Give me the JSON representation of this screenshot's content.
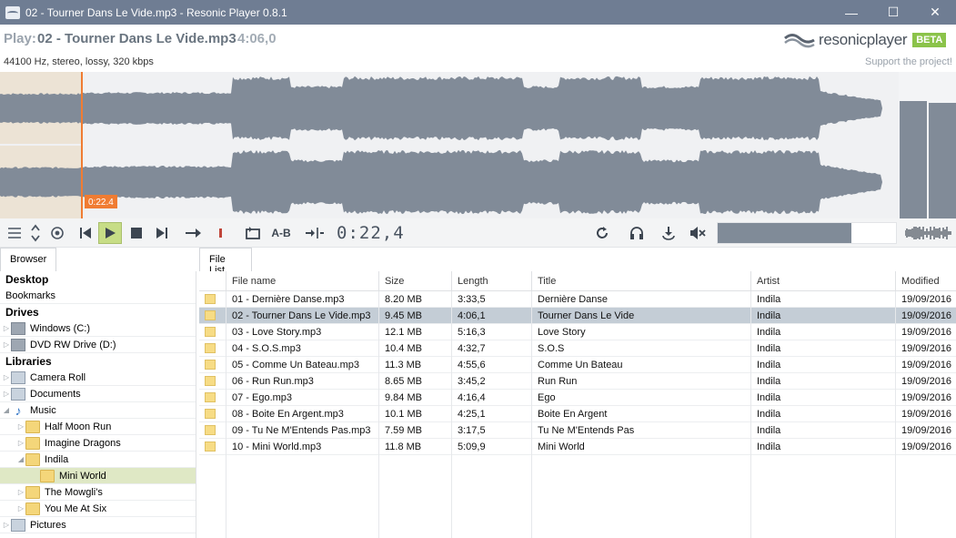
{
  "window": {
    "title": "02 - Tourner Dans Le Vide.mp3 - Resonic Player 0.8.1",
    "minimize": "—",
    "maximize": "☐",
    "close": "✕"
  },
  "header": {
    "play_label": "Play:",
    "file": "02 - Tourner Dans Le Vide.mp3",
    "duration": "4:06,0",
    "logo_text_1": "resonic",
    "logo_text_2": "player",
    "beta": "BETA"
  },
  "info": {
    "format": "44100 Hz, stereo, lossy, 320 kbps",
    "support": "Support the project!"
  },
  "waveform": {
    "playhead_label": "0:22.4",
    "playhead_fraction": 0.091,
    "vu_levels": [
      0.8,
      0.79
    ],
    "colors": {
      "wave": "#818b98",
      "played_bg": "#ece3d5",
      "playhead": "#f07c32"
    }
  },
  "toolbar": {
    "timecode": "0:22,4",
    "ab_label": "A-B",
    "progress_fraction": 0.75
  },
  "tabs": {
    "browser": "Browser",
    "file_list": "File List"
  },
  "browser": [
    {
      "label": "Desktop",
      "kind": "section"
    },
    {
      "label": "Bookmarks",
      "kind": "plain"
    },
    {
      "label": "Drives",
      "kind": "section"
    },
    {
      "label": "Windows (C:)",
      "kind": "drive",
      "depth": 0
    },
    {
      "label": "DVD RW Drive (D:)",
      "kind": "drive",
      "depth": 0
    },
    {
      "label": "Libraries",
      "kind": "section"
    },
    {
      "label": "Camera Roll",
      "kind": "library",
      "depth": 0
    },
    {
      "label": "Documents",
      "kind": "library",
      "depth": 0
    },
    {
      "label": "Music",
      "kind": "music",
      "depth": 0,
      "expanded": true
    },
    {
      "label": "Half Moon Run",
      "kind": "folder",
      "depth": 1
    },
    {
      "label": "Imagine Dragons",
      "kind": "folder",
      "depth": 1
    },
    {
      "label": "Indila",
      "kind": "folder",
      "depth": 1,
      "expanded": true
    },
    {
      "label": "Mini World",
      "kind": "folder",
      "depth": 2,
      "selected": true
    },
    {
      "label": "The Mowgli's",
      "kind": "folder",
      "depth": 1
    },
    {
      "label": "You Me At Six",
      "kind": "folder",
      "depth": 1
    },
    {
      "label": "Pictures",
      "kind": "library",
      "depth": 0
    }
  ],
  "file_list": {
    "columns": [
      "File name",
      "Size",
      "Length",
      "Title",
      "Artist",
      "Modified"
    ],
    "rows": [
      [
        "01 - Dernière Danse.mp3",
        "8.20 MB",
        "3:33,5",
        "Dernière Danse",
        "Indila",
        "19/09/2016"
      ],
      [
        "02 - Tourner Dans Le Vide.mp3",
        "9.45 MB",
        "4:06,1",
        "Tourner Dans Le Vide",
        "Indila",
        "19/09/2016"
      ],
      [
        "03 - Love Story.mp3",
        "12.1 MB",
        "5:16,3",
        "Love Story",
        "Indila",
        "19/09/2016"
      ],
      [
        "04 - S.O.S.mp3",
        "10.4 MB",
        "4:32,7",
        "S.O.S",
        "Indila",
        "19/09/2016"
      ],
      [
        "05 - Comme Un Bateau.mp3",
        "11.3 MB",
        "4:55,6",
        "Comme Un Bateau",
        "Indila",
        "19/09/2016"
      ],
      [
        "06 - Run Run.mp3",
        "8.65 MB",
        "3:45,2",
        "Run Run",
        "Indila",
        "19/09/2016"
      ],
      [
        "07 - Ego.mp3",
        "9.84 MB",
        "4:16,4",
        "Ego",
        "Indila",
        "19/09/2016"
      ],
      [
        "08 - Boite En Argent.mp3",
        "10.1 MB",
        "4:25,1",
        "Boite En Argent",
        "Indila",
        "19/09/2016"
      ],
      [
        "09 - Tu Ne M'Entends Pas.mp3",
        "7.59 MB",
        "3:17,5",
        "Tu Ne M'Entends Pas",
        "Indila",
        "19/09/2016"
      ],
      [
        "10 - Mini World.mp3",
        "11.8 MB",
        "5:09,9",
        "Mini World",
        "Indila",
        "19/09/2016"
      ]
    ],
    "selected_index": 1
  }
}
